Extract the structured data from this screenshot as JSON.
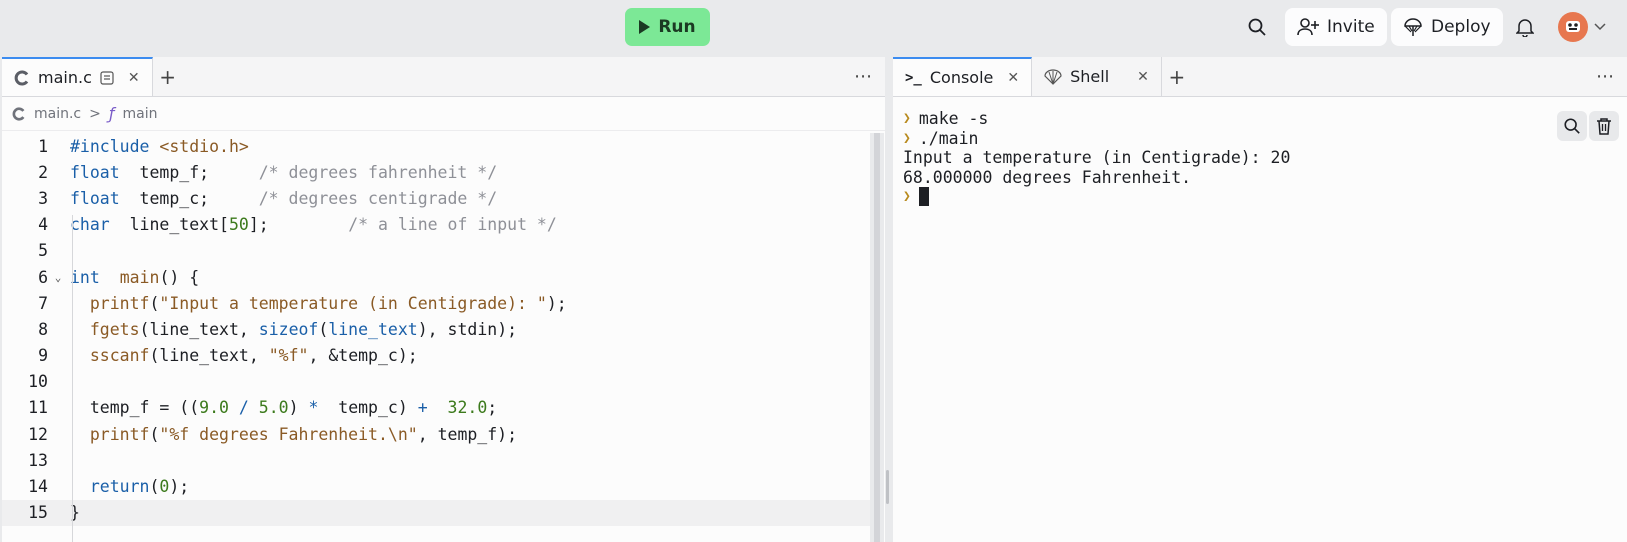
{
  "toolbar": {
    "run_label": "Run",
    "invite_label": "Invite",
    "deploy_label": "Deploy"
  },
  "editor": {
    "tab_label": "main.c",
    "breadcrumb": {
      "file": "main.c",
      "separator": ">",
      "symbol_glyph": "ƒ",
      "symbol": "main"
    },
    "current_line": 15
  },
  "console": {
    "tabs": [
      {
        "label": "Console"
      },
      {
        "label": "Shell"
      }
    ],
    "lines": [
      {
        "prompt": true,
        "text": "make -s"
      },
      {
        "prompt": true,
        "text": "./main"
      },
      {
        "prompt": false,
        "text": "Input a temperature (in Centigrade): 20"
      },
      {
        "prompt": false,
        "text": "68.000000 degrees Fahrenheit."
      }
    ]
  },
  "colors": {
    "run_button": "#7ce896",
    "active_tab_accent": "#3c8cf0",
    "keyword": "#1a5fa8",
    "string": "#8a5a25",
    "number": "#3c7a1c",
    "comment": "#8e9097",
    "prompt": "#b88a1e",
    "avatar": "#e7774f"
  },
  "icons": [
    "c-language-icon",
    "search-icon",
    "add-user-icon",
    "deploy-icon",
    "bell-icon",
    "avatar",
    "chevron-down-icon",
    "console-icon",
    "shell-icon",
    "trash-icon",
    "function-icon"
  ],
  "code_lines": [
    [
      [
        "kw",
        "#include "
      ],
      [
        "str",
        "<stdio.h>"
      ]
    ],
    [
      [
        "kw",
        "float"
      ],
      [
        "",
        "  temp_f;     "
      ],
      [
        "cm",
        "/* degrees fahrenheit */"
      ]
    ],
    [
      [
        "kw",
        "float"
      ],
      [
        "",
        "  temp_c;     "
      ],
      [
        "cm",
        "/* degrees centigrade */"
      ]
    ],
    [
      [
        "kw",
        "char"
      ],
      [
        "",
        "  line_text["
      ],
      [
        "num",
        "50"
      ],
      [
        "",
        "];        "
      ],
      [
        "cm",
        "/* a line of input */"
      ]
    ],
    [],
    [
      [
        "kw",
        "int"
      ],
      [
        "",
        "  "
      ],
      [
        "fn",
        "main"
      ],
      [
        "",
        "() {"
      ]
    ],
    [
      [
        "",
        "  "
      ],
      [
        "fn",
        "printf"
      ],
      [
        "",
        "("
      ],
      [
        "str",
        "\"Input a temperature (in Centigrade): \""
      ],
      [
        "",
        ");"
      ]
    ],
    [
      [
        "",
        "  "
      ],
      [
        "fn",
        "fgets"
      ],
      [
        "",
        "(line_text, "
      ],
      [
        "kw",
        "sizeof"
      ],
      [
        "",
        "("
      ],
      [
        "kw",
        "line_text"
      ],
      [
        "",
        "), stdin);"
      ]
    ],
    [
      [
        "",
        "  "
      ],
      [
        "fn",
        "sscanf"
      ],
      [
        "",
        "(line_text, "
      ],
      [
        "str",
        "\"%f\""
      ],
      [
        "",
        ", &temp_c);"
      ]
    ],
    [],
    [
      [
        "",
        "  temp_f = (("
      ],
      [
        "num",
        "9.0"
      ],
      [
        "op",
        " / "
      ],
      [
        "num",
        "5.0"
      ],
      [
        "",
        ") "
      ],
      [
        "op",
        "*"
      ],
      [
        "",
        "  temp_c) "
      ],
      [
        "op",
        "+"
      ],
      [
        "",
        "  "
      ],
      [
        "num",
        "32.0"
      ],
      [
        "",
        ";"
      ]
    ],
    [
      [
        "",
        "  "
      ],
      [
        "fn",
        "printf"
      ],
      [
        "",
        "("
      ],
      [
        "str",
        "\"%f degrees Fahrenheit.\\n\""
      ],
      [
        "",
        ", temp_f);"
      ]
    ],
    [],
    [
      [
        "",
        "  "
      ],
      [
        "kw",
        "return"
      ],
      [
        "",
        "("
      ],
      [
        "num",
        "0"
      ],
      [
        "",
        ");"
      ]
    ],
    [
      [
        "",
        "}"
      ]
    ]
  ]
}
